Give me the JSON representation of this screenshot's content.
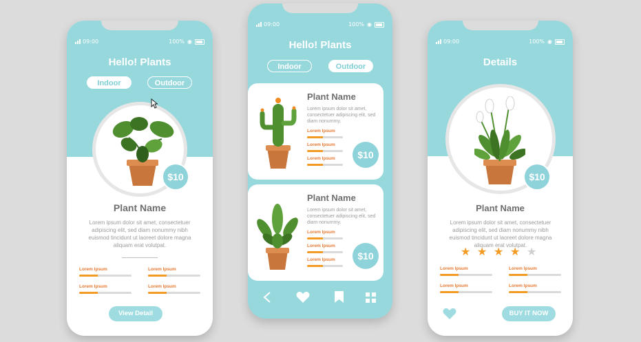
{
  "status": {
    "time": "09:00",
    "battery": "100%"
  },
  "phone1": {
    "title": "Hello! Plants",
    "tabs": [
      {
        "label": "Indoor",
        "active": true
      },
      {
        "label": "Outdoor",
        "active": false
      }
    ],
    "price": "$10",
    "plant_name": "Plant Name",
    "description": "Lorem ipsum dolor sit amet, consectetuer adipiscing elit, sed diam nonummy nibh euismod tincidunt ut laoreet dolore magna aliquam erat volutpat.",
    "stats": [
      {
        "label": "Lorem Ipsum",
        "fill": 0.35
      },
      {
        "label": "Lorem Ipsum",
        "fill": 0.35
      },
      {
        "label": "Lorem Ipsum",
        "fill": 0.35
      },
      {
        "label": "Lorem Ipsum",
        "fill": 0.35
      }
    ],
    "button": "View Detail"
  },
  "phone2": {
    "title": "Hello! Plants",
    "tabs": [
      {
        "label": "Indoor",
        "active": false
      },
      {
        "label": "Outdoor",
        "active": true
      }
    ],
    "cards": [
      {
        "plant_name": "Plant Name",
        "description": "Lorem ipsum dolor sit amet, consectetuer adipiscing elit, sed diam nonummy.",
        "stats": [
          {
            "label": "Lorem Ipsum",
            "fill": 0.45
          },
          {
            "label": "Lorem Ipsum",
            "fill": 0.45
          },
          {
            "label": "Lorem Ipsum",
            "fill": 0.45
          }
        ],
        "price": "$10"
      },
      {
        "plant_name": "Plant Name",
        "description": "Lorem ipsum dolor sit amet, consectetuer adipiscing elit, sed diam nonummy.",
        "stats": [
          {
            "label": "Lorem Ipsum",
            "fill": 0.45
          },
          {
            "label": "Lorem Ipsum",
            "fill": 0.45
          },
          {
            "label": "Lorem Ipsum",
            "fill": 0.45
          }
        ],
        "price": "$10"
      }
    ],
    "nav": [
      "back-icon",
      "heart-icon",
      "bookmark-icon",
      "grid-icon"
    ]
  },
  "phone3": {
    "title": "Details",
    "price": "$10",
    "plant_name": "Plant Name",
    "description": "Lorem ipsum dolor sit amet, consectetuer adipiscing elit, sed diam nonummy nibh euismod tincidunt ut laoreet dolore magna aliquam erat volutpat.",
    "rating": 4,
    "rating_max": 5,
    "stats": [
      {
        "label": "Lorem Ipsum",
        "fill": 0.35
      },
      {
        "label": "Lorem Ipsum",
        "fill": 0.35
      },
      {
        "label": "Lorem Ipsum",
        "fill": 0.35
      },
      {
        "label": "Lorem Ipsum",
        "fill": 0.35
      }
    ],
    "button": "BUY IT NOW"
  },
  "colors": {
    "teal": "#97d8dd",
    "orange": "#f29a21",
    "label_orange": "#e6772e",
    "bg": "#dcdcdc"
  }
}
